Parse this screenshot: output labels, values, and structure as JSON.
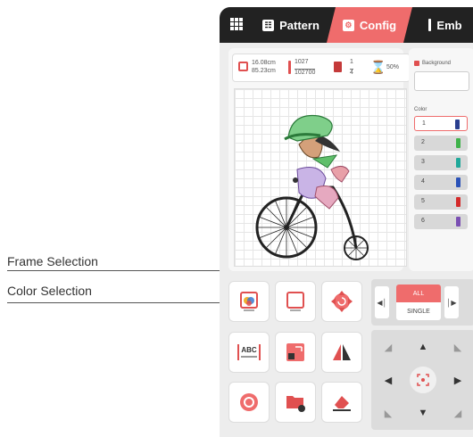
{
  "callouts": {
    "frame_selection": "Frame Selection",
    "color_selection": "Color Selection"
  },
  "tabs": [
    {
      "label": "Pattern",
      "icon": "pattern-icon"
    },
    {
      "label": "Config",
      "icon": "config-icon",
      "active": true
    },
    {
      "label": "Emb",
      "icon": "needle-icon"
    }
  ],
  "info": {
    "width": "16.08cm",
    "height": "85.23cm",
    "stitches_done": "1027",
    "stitches_total": "102700",
    "color_index": "1",
    "color_total": "4",
    "progress": "50%"
  },
  "background_label": "Background",
  "color_label": "Color",
  "colors": [
    {
      "num": "1",
      "spool": "#2a3f8f",
      "selected": true
    },
    {
      "num": "2",
      "spool": "#3fb24a"
    },
    {
      "num": "3",
      "spool": "#1fa89a"
    },
    {
      "num": "4",
      "spool": "#2a52b8"
    },
    {
      "num": "5",
      "spool": "#d42a2a"
    },
    {
      "num": "6",
      "spool": "#7a4fb3"
    }
  ],
  "mode": {
    "all": "ALL",
    "single": "SINGLE"
  },
  "tools": [
    "color-selection",
    "frame-selection",
    "rotate",
    "text-measure",
    "resize",
    "mirror",
    "loop",
    "add-folder",
    "eraser"
  ],
  "accent": "#ef6c6c"
}
